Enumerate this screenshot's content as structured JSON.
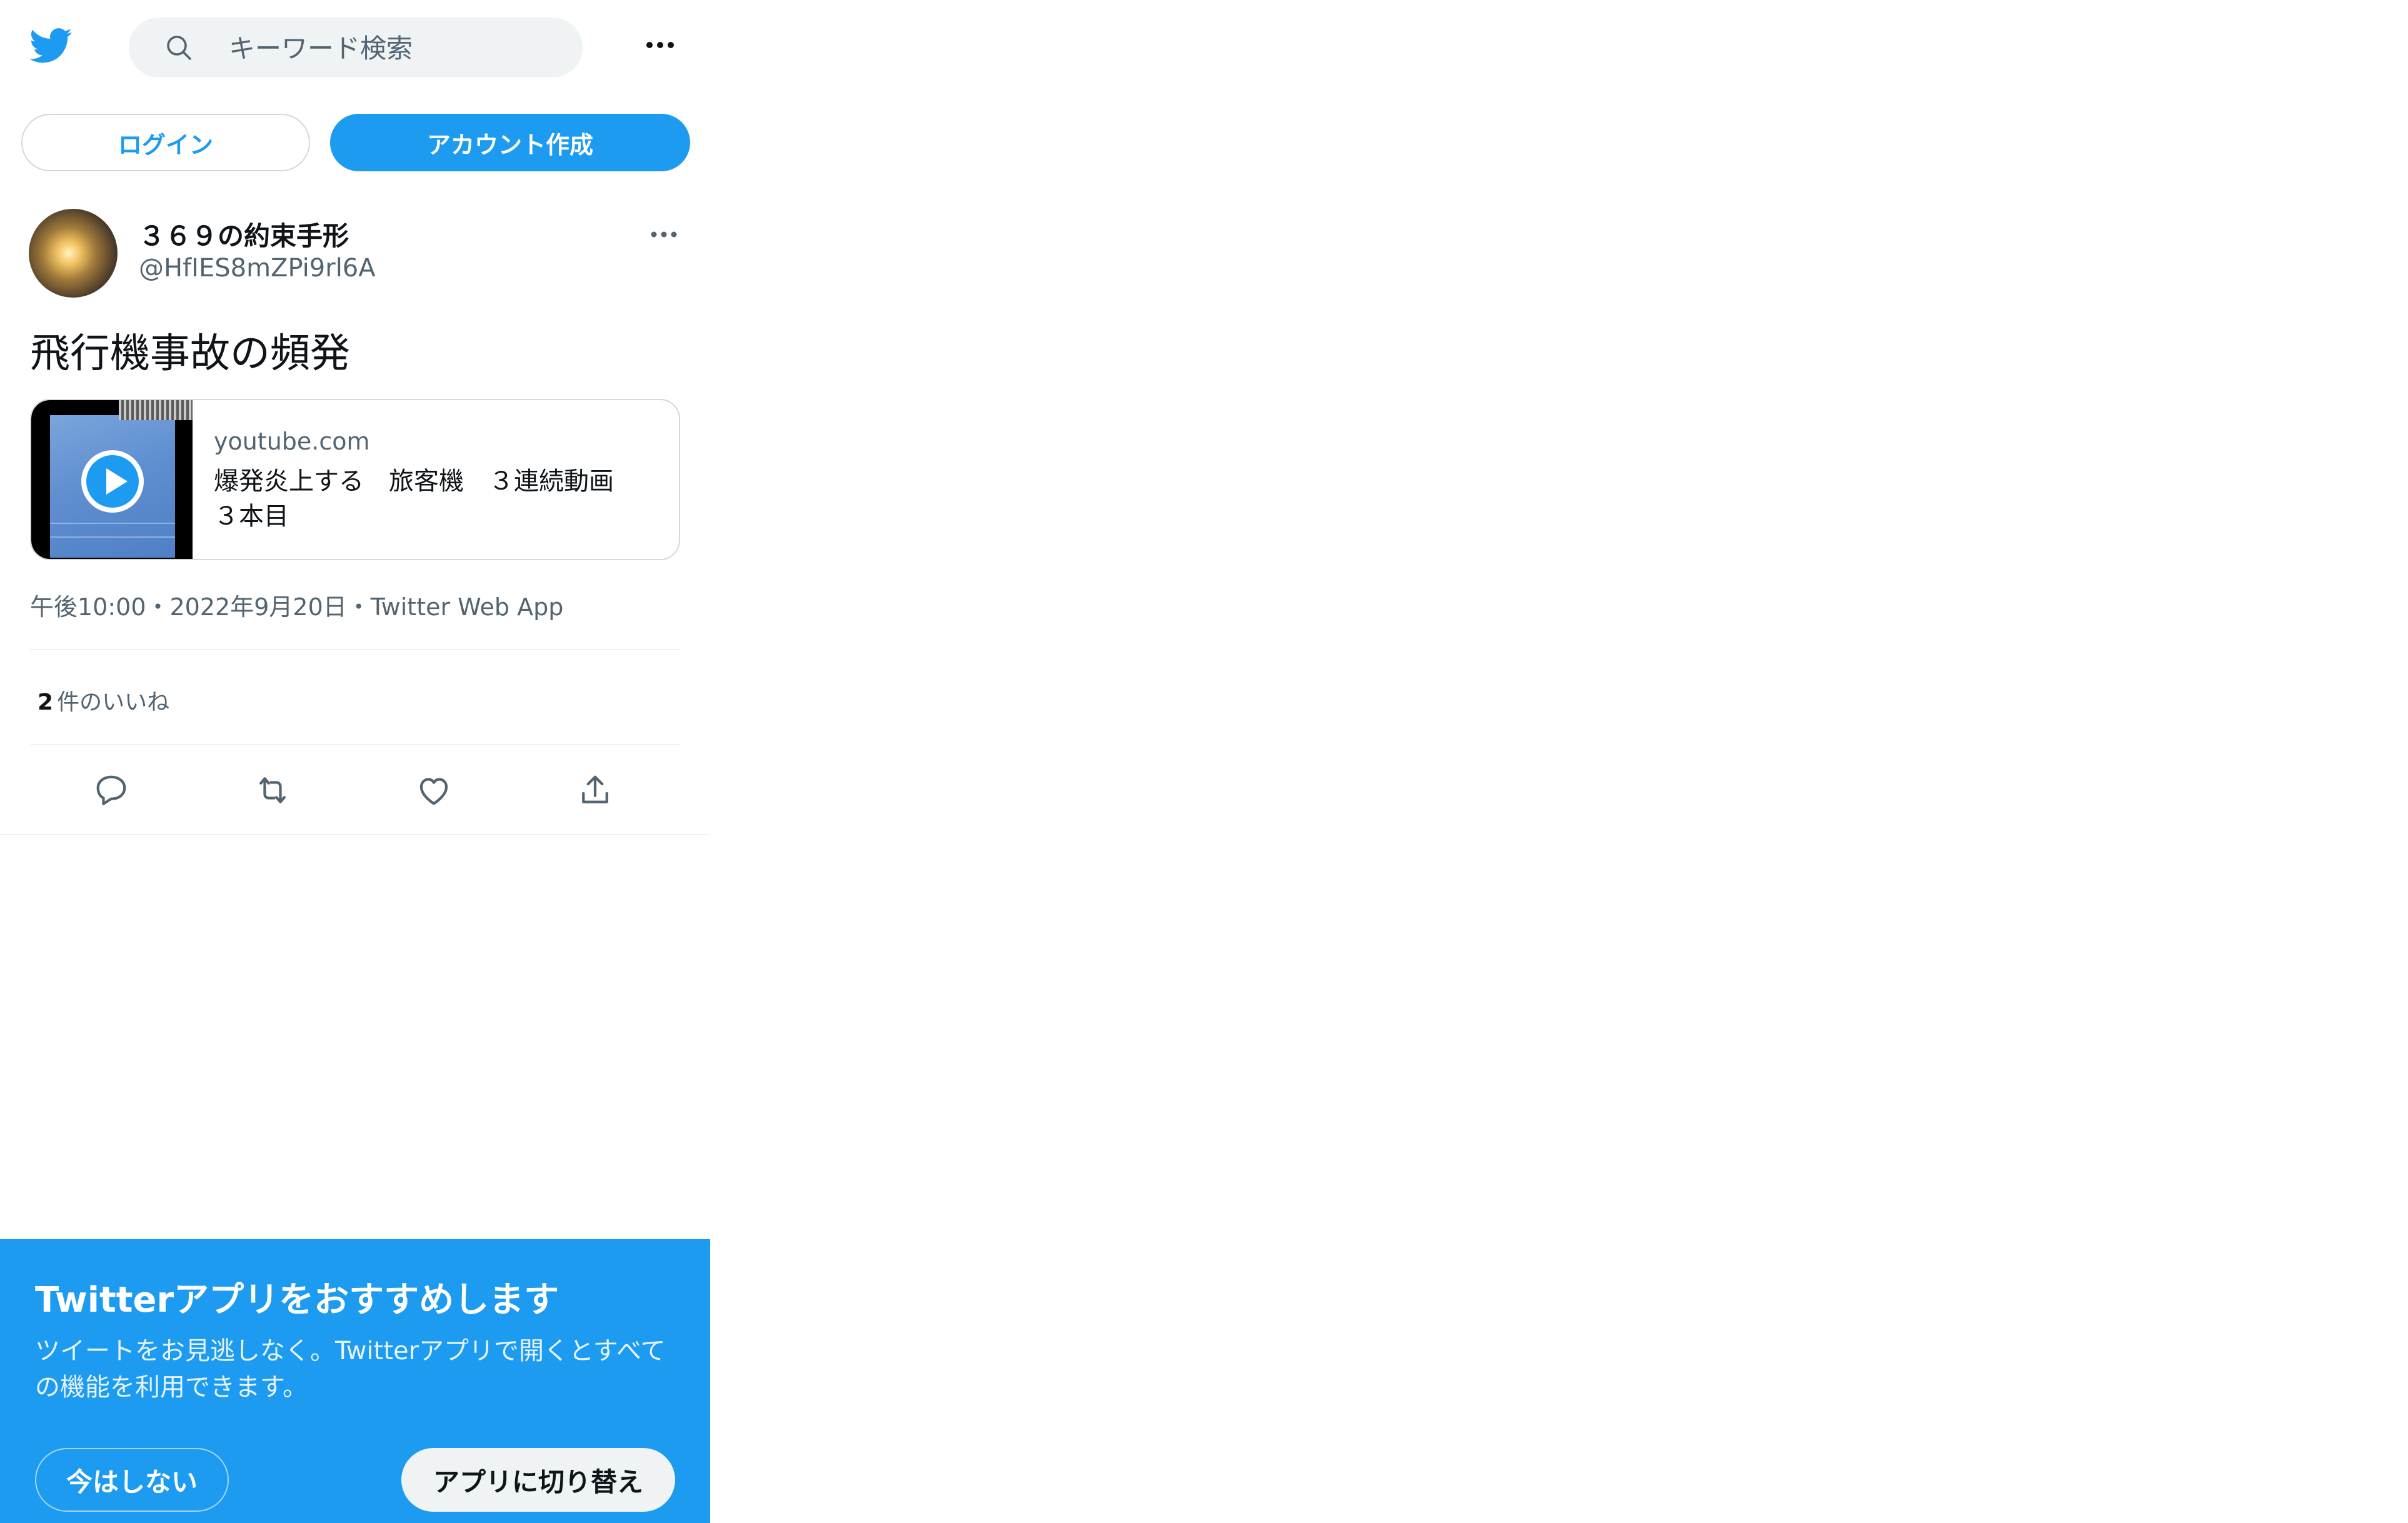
{
  "header": {
    "logo_icon": "twitter-bird-icon",
    "search_placeholder": "キーワード検索",
    "more_icon": "more-horizontal-icon"
  },
  "auth": {
    "login_label": "ログイン",
    "signup_label": "アカウント作成"
  },
  "tweet": {
    "display_name": "３６９の約束手形",
    "handle": "@HfIES8mZPi9rl6A",
    "text": "飛行機事故の頻発",
    "card": {
      "domain": "youtube.com",
      "title": "爆発炎上する　旅客機　３連続動画　３本目"
    },
    "meta": "午後10:00・2022年9月20日・Twitter Web App",
    "likes_count": "2",
    "likes_label": "件のいいね"
  },
  "actions": [
    "reply-icon",
    "retweet-icon",
    "like-icon",
    "share-icon"
  ],
  "promo": {
    "title": "Twitterアプリをおすすめします",
    "description": "ツイートをお見逃しなく。Twitterアプリで開くとすべての機能を利用できます。",
    "dismiss_label": "今はしない",
    "switch_label": "アプリに切り替え"
  },
  "colors": {
    "brand_blue": "#1d9bf0",
    "text_primary": "#0f1419",
    "text_secondary": "#536471",
    "border": "#cfd9de"
  }
}
